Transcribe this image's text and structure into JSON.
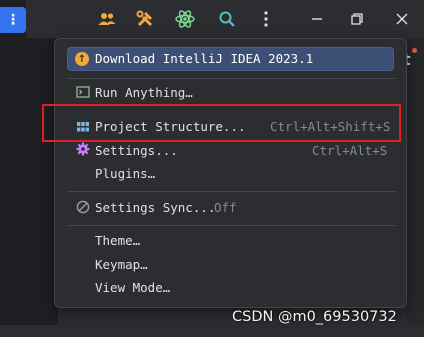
{
  "toolbar": {
    "main_menu_glyph": "⋮",
    "icons": [
      "user-group-icon",
      "build-tools-icon",
      "atom-plugin-icon",
      "search-icon",
      "more-icon",
      "minimize-icon",
      "restore-icon",
      "close-icon"
    ]
  },
  "side_panel": {
    "visible_letter": "t"
  },
  "menu": {
    "banner": {
      "icon": "arrow-up-icon",
      "label": "Download IntelliJ IDEA 2023.1"
    },
    "items": [
      {
        "label": "Run Anything…",
        "shortcut": "",
        "icon": "terminal-icon"
      },
      {
        "label": "Project Structure...",
        "shortcut": "Ctrl+Alt+Shift+S",
        "icon": "project-structure-icon"
      },
      {
        "label": "Settings...",
        "shortcut": "Ctrl+Alt+S",
        "icon": "gear-icon"
      },
      {
        "label": "Plugins…",
        "shortcut": "",
        "icon": ""
      },
      {
        "label": "Settings Sync...",
        "status": "Off",
        "icon": "sync-off-icon"
      },
      {
        "label": "Theme…",
        "icon": ""
      },
      {
        "label": "Keymap…",
        "icon": ""
      },
      {
        "label": "View Mode…",
        "icon": ""
      }
    ]
  },
  "watermark": "CSDN @m0_69530732",
  "colors": {
    "accent": "#3574f0",
    "banner": "#3d4f74",
    "highlight": "#e02020",
    "gear": "#c77dff"
  }
}
